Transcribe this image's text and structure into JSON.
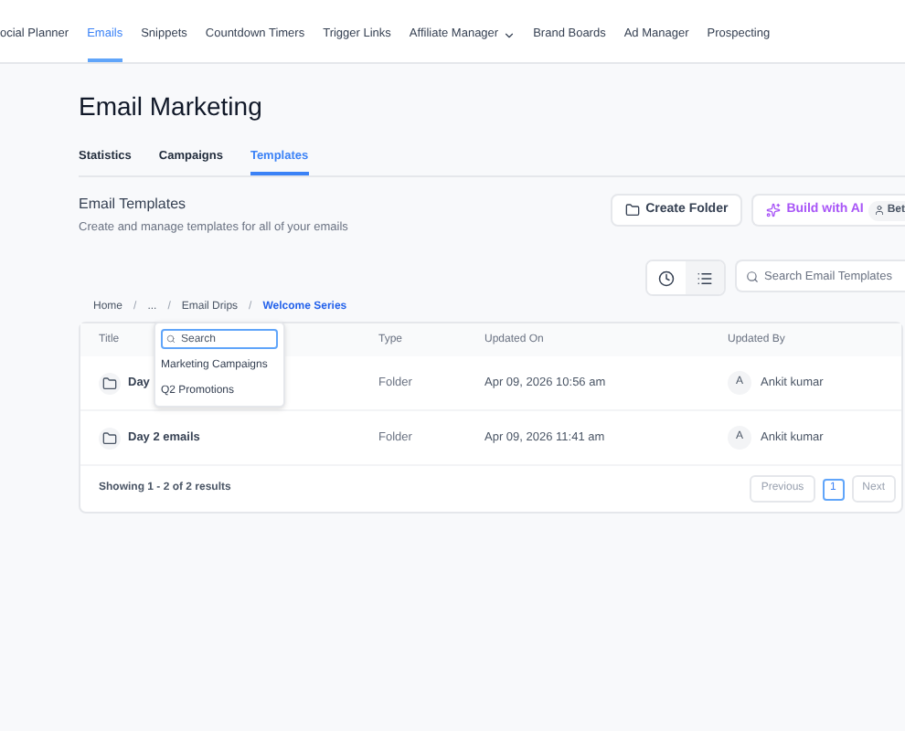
{
  "nav": [
    {
      "label": "ocial Planner",
      "selected": false,
      "dropdown": false
    },
    {
      "label": "Emails",
      "selected": true,
      "dropdown": false
    },
    {
      "label": "Snippets",
      "selected": false,
      "dropdown": false
    },
    {
      "label": "Countdown Timers",
      "selected": false,
      "dropdown": false
    },
    {
      "label": "Trigger Links",
      "selected": false,
      "dropdown": false
    },
    {
      "label": "Affiliate Manager",
      "selected": false,
      "dropdown": true
    },
    {
      "label": "Brand Boards",
      "selected": false,
      "dropdown": false
    },
    {
      "label": "Ad Manager",
      "selected": false,
      "dropdown": false
    },
    {
      "label": "Prospecting",
      "selected": false,
      "dropdown": false
    }
  ],
  "page_title": "Email Marketing",
  "tabs": [
    {
      "label": "Statistics",
      "selected": false
    },
    {
      "label": "Campaigns",
      "selected": false
    },
    {
      "label": "Templates",
      "selected": true
    }
  ],
  "section": {
    "title": "Email Templates",
    "subtitle": "Create and manage templates for all of your emails"
  },
  "actions": {
    "create_folder": "Create Folder",
    "build_ai": "Build with AI",
    "badge": "Bet"
  },
  "view_toggle": [
    {
      "kind": "recent",
      "selected": false
    },
    {
      "kind": "list",
      "selected": true
    }
  ],
  "search": {
    "placeholder": "Search Email Templates"
  },
  "breadcrumb_separator": "/",
  "breadcrumb": [
    {
      "label": "Home",
      "current": false
    },
    {
      "label": "...",
      "current": false
    },
    {
      "label": "Email Drips",
      "current": false
    },
    {
      "label": "Welcome Series",
      "current": true
    }
  ],
  "popover": {
    "placeholder": "Search",
    "items": [
      "Marketing Campaigns",
      "Q2 Promotions"
    ]
  },
  "table": {
    "columns": [
      "Title",
      "Type",
      "Updated On",
      "Updated By"
    ],
    "rows": [
      {
        "title": "Day",
        "type": "Folder",
        "updated_on": "Apr 09, 2026 10:56 am",
        "avatar": "A",
        "updated_by": "Ankit kumar"
      },
      {
        "title": "Day 2 emails",
        "type": "Folder",
        "updated_on": "Apr 09, 2026 11:41 am",
        "avatar": "A",
        "updated_by": "Ankit kumar"
      }
    ]
  },
  "footer": {
    "summary": "Showing 1 - 2 of 2 results",
    "previous": "Previous",
    "pages": [
      {
        "label": "1",
        "selected": true
      }
    ],
    "next": "Next"
  }
}
